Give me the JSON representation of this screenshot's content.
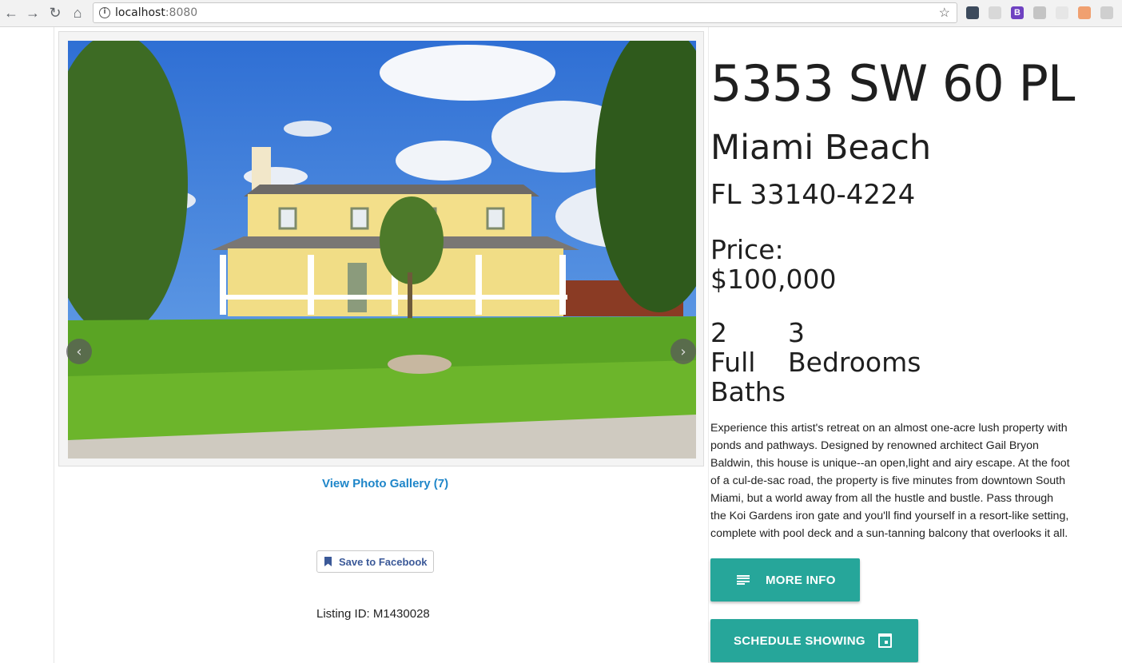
{
  "browser": {
    "url_host": "localhost",
    "url_port": ":8080",
    "back": "←",
    "forward": "→",
    "reload": "↻",
    "home": "⌂",
    "star": "☆",
    "info": "i",
    "extensions": [
      "extension-icon",
      "cast-icon",
      "bootstrap-icon",
      "layers-icon",
      "blank-icon",
      "face-icon",
      "settings-icon"
    ],
    "bootstrap_letter": "B"
  },
  "carousel": {
    "prev": "‹",
    "next": "›"
  },
  "gallery_link": "View Photo Gallery (7)",
  "facebook_button": "Save to Facebook",
  "listing_id": "Listing ID: M1430028",
  "property": {
    "address": "5353 SW 60 PL",
    "city": "Miami Beach",
    "state_zip": "FL 33140-4224",
    "price_label": "Price:",
    "price": "$100,000",
    "baths_count": "2",
    "baths_label_1": "Full",
    "baths_label_2": "Baths",
    "beds_count": "3",
    "beds_label": "Bedrooms",
    "description": "Experience this artist's retreat on an almost one-acre lush property with ponds and pathways. Designed by renowned architect Gail Bryon Baldwin, this house is unique--an open,light and airy escape. At the foot of a cul-de-sac road, the property is five minutes from downtown South Miami, but a world away from all the hustle and bustle. Pass through the Koi Gardens iron gate and you'll find yourself in a resort-like setting, complete with pool deck and a sun-tanning balcony that overlooks it all."
  },
  "buttons": {
    "more_info": "MORE INFO",
    "schedule": "SCHEDULE SHOWING"
  },
  "colors": {
    "accent": "#26a69a",
    "link": "#1f86c9",
    "facebook": "#3b5998"
  }
}
